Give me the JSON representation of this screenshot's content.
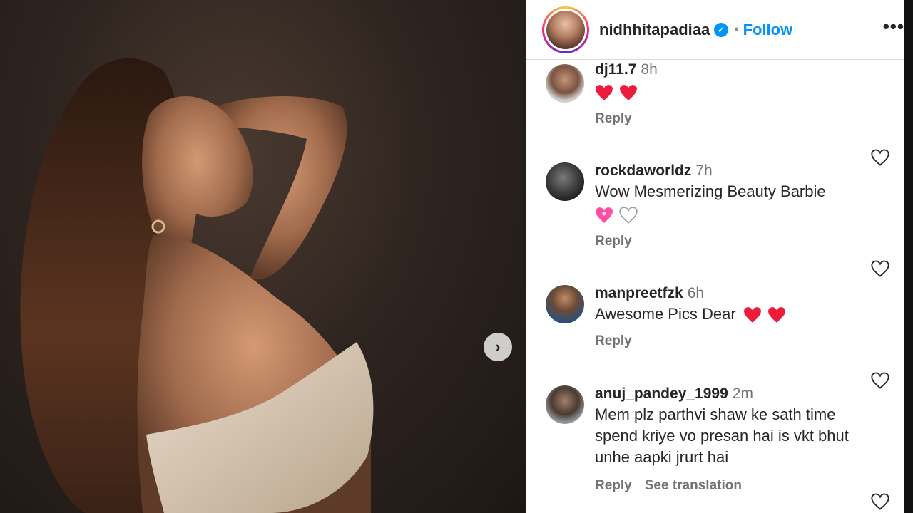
{
  "post": {
    "username": "nidhhitapadiaa",
    "follow_label": "Follow",
    "separator": "•",
    "more_label": "•••",
    "next_label": "›"
  },
  "comments": [
    {
      "username": "dj11.7",
      "time": "8h",
      "text": "",
      "emojis": [
        "red-heart",
        "red-heart"
      ],
      "reply": "Reply"
    },
    {
      "username": "rockdaworldz",
      "time": "7h",
      "text": "Wow Mesmerizing Beauty Barbie",
      "emojis": [
        "sparkling-heart",
        "white-heart"
      ],
      "reply": "Reply"
    },
    {
      "username": "manpreetfzk",
      "time": "6h",
      "text": "Awesome Pics Dear",
      "emojis": [
        "red-heart",
        "red-heart"
      ],
      "reply": "Reply"
    },
    {
      "username": "anuj_pandey_1999",
      "time": "2m",
      "text": "Mem plz parthvi shaw ke sath time spend kriye vo presan hai is vkt bhut unhe aapki jrurt hai",
      "emojis": [],
      "reply": "Reply",
      "translation": "See translation"
    }
  ],
  "colors": {
    "accent": "#0095f6",
    "text": "#262626",
    "muted": "#737373",
    "heart": "#ed1c3a"
  }
}
